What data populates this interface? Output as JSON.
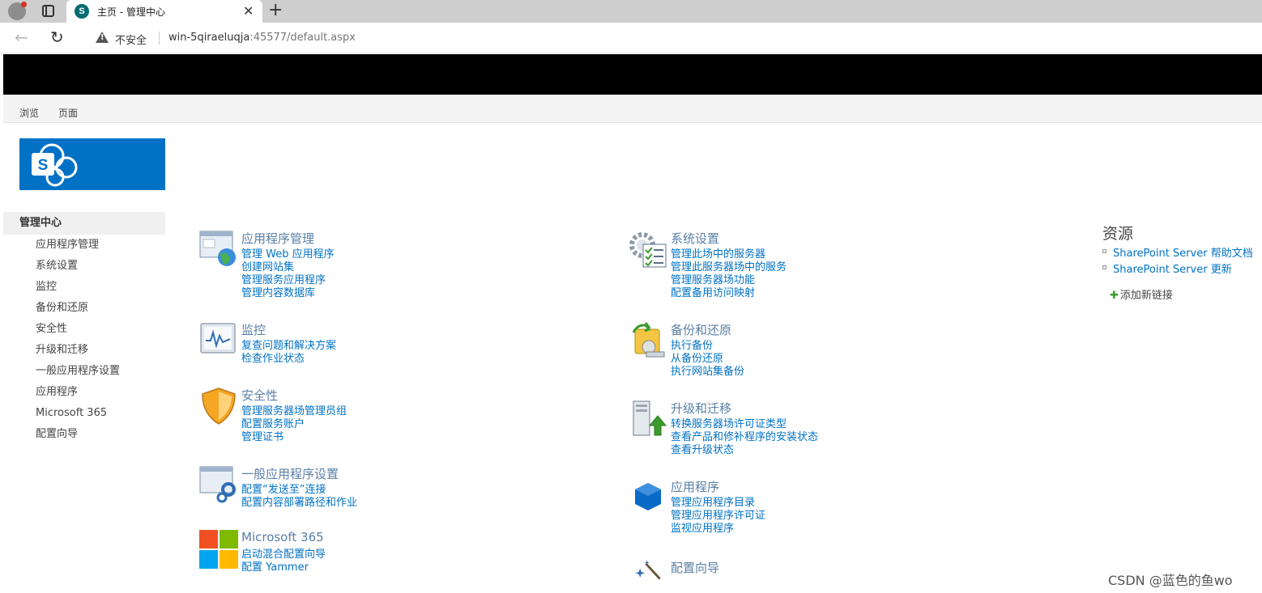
{
  "browser": {
    "tab_title": "主页 - 管理中心",
    "tab_favicon": "S",
    "insecure_label": "不安全",
    "url_host": "win-5qiraeluqja",
    "url_path": ":45577/default.aspx"
  },
  "ribbon": {
    "browse": "浏览",
    "page": "页面"
  },
  "logo": {
    "letter": "S"
  },
  "quicklaunch": {
    "heading": "管理中心",
    "items": [
      "应用程序管理",
      "系统设置",
      "监控",
      "备份和还原",
      "安全性",
      "升级和迁移",
      "一般应用程序设置",
      "应用程序",
      "Microsoft 365",
      "配置向导"
    ]
  },
  "sections": {
    "app_mgmt": {
      "title": "应用程序管理",
      "icon": "web-app-icon",
      "links": [
        "管理 Web 应用程序",
        "创建网站集",
        "管理服务应用程序",
        "管理内容数据库"
      ]
    },
    "system": {
      "title": "系统设置",
      "icon": "gear-checklist-icon",
      "links": [
        "管理此场中的服务器",
        "管理此服务器场中的服务",
        "管理服务器场功能",
        "配置备用访问映射"
      ]
    },
    "monitor": {
      "title": "监控",
      "icon": "monitor-chart-icon",
      "links": [
        "复查问题和解决方案",
        "检查作业状态"
      ]
    },
    "backup": {
      "title": "备份和还原",
      "icon": "backup-restore-icon",
      "links": [
        "执行备份",
        "从备份还原",
        "执行网站集备份"
      ]
    },
    "security": {
      "title": "安全性",
      "icon": "shield-icon",
      "links": [
        "管理服务器场管理员组",
        "配置服务账户",
        "管理证书"
      ]
    },
    "upgrade": {
      "title": "升级和迁移",
      "icon": "server-upgrade-icon",
      "links": [
        "转换服务器场许可证类型",
        "查看产品和修补程序的安装状态",
        "查看升级状态"
      ]
    },
    "general": {
      "title": "一般应用程序设置",
      "icon": "window-gears-icon",
      "links": [
        "配置“发送至”连接",
        "配置内容部署路径和作业"
      ]
    },
    "apps": {
      "title": "应用程序",
      "icon": "cube-icon",
      "links": [
        "管理应用程序目录",
        "管理应用程序许可证",
        "监视应用程序"
      ]
    },
    "m365": {
      "title": "Microsoft 365",
      "icon": "microsoft-logo-icon",
      "links": [
        "启动混合配置向导",
        "配置 Yammer"
      ]
    },
    "wizard": {
      "title": "配置向导",
      "icon": "magic-wand-icon",
      "links": []
    }
  },
  "resources": {
    "title": "资源",
    "links": [
      "SharePoint Server 帮助文档",
      "SharePoint Server 更新"
    ],
    "add_link": "添加新链接"
  },
  "watermark": "CSDN @蓝色的鱼wo",
  "colors": {
    "link": "#0072c6",
    "section_title": "#5b7fa6",
    "brand_blue": "#0072c6",
    "suitebar": "#000000"
  }
}
